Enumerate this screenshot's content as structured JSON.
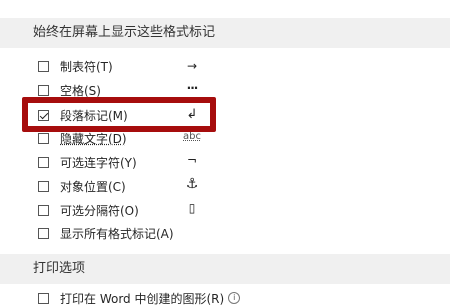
{
  "sections": {
    "display_title": "始终在屏幕上显示这些格式标记",
    "print_title": "打印选项"
  },
  "options": [
    {
      "label": "制表符(T)",
      "checked": false,
      "mark": "→"
    },
    {
      "label": "空格(S)",
      "checked": false,
      "mark": "···"
    },
    {
      "label": "段落标记(M)",
      "checked": true,
      "mark": "↲"
    },
    {
      "label": "隐藏文字(D)",
      "checked": false,
      "mark": "abc"
    },
    {
      "label": "可选连字符(Y)",
      "checked": false,
      "mark": "¬"
    },
    {
      "label": "对象位置(C)",
      "checked": false,
      "mark": "⚓"
    },
    {
      "label": "可选分隔符(O)",
      "checked": false,
      "mark": "▯"
    },
    {
      "label": "显示所有格式标记(A)",
      "checked": false,
      "mark": ""
    }
  ],
  "print_options": [
    {
      "label": "打印在 Word 中创建的图形(R)",
      "checked": false,
      "info_icon": "info-icon"
    }
  ],
  "colors": {
    "highlight_border": "#a60d0d",
    "section_bg": "#f0f0f0"
  }
}
